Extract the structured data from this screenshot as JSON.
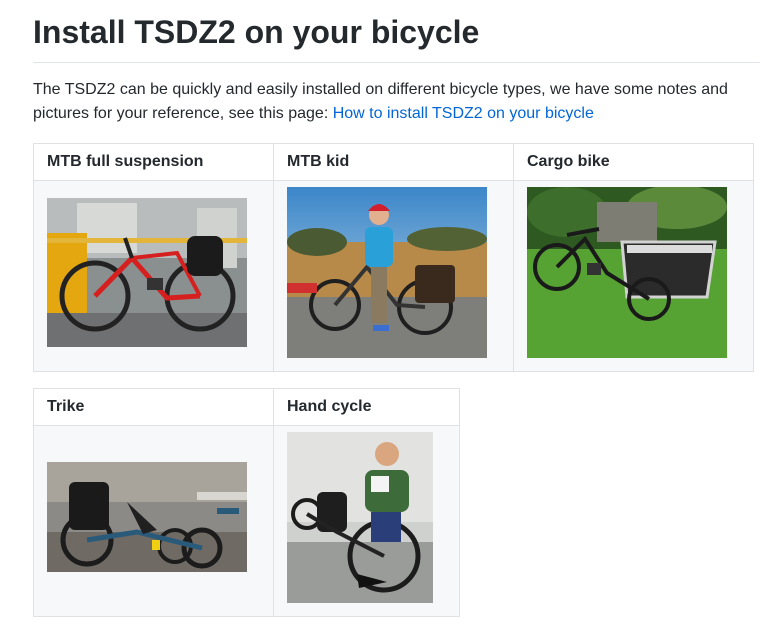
{
  "page": {
    "title": "Install TSDZ2 on your bicycle",
    "intro_text": "The TSDZ2 can be quickly and easily installed on different bicycle types, we have some notes and pictures for your reference, see this page: ",
    "intro_link": "How to install TSDZ2 on your bicycle"
  },
  "tables": [
    {
      "headers": [
        "MTB full suspension",
        "MTB kid",
        "Cargo bike"
      ]
    },
    {
      "headers": [
        "Trike",
        "Hand cycle"
      ]
    }
  ]
}
